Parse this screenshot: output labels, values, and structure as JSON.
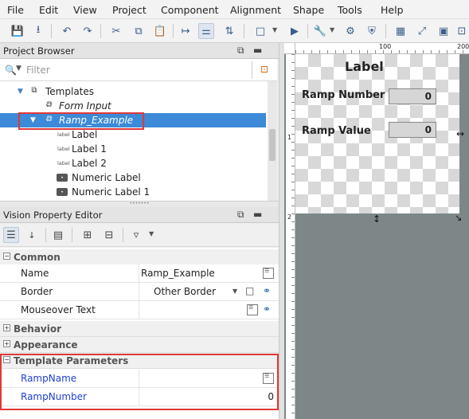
{
  "menubar": {
    "items": [
      "File",
      "Edit",
      "View",
      "Project",
      "Component",
      "Alignment",
      "Shape",
      "Tools",
      "Help"
    ]
  },
  "project_browser": {
    "title": "Project Browser",
    "filter_placeholder": "Filter",
    "tree": [
      {
        "label": "Templates",
        "icon": "folder-icon",
        "italic": false
      },
      {
        "label": "Form Input",
        "icon": "template-icon",
        "italic": true
      },
      {
        "label": "Ramp_Example",
        "icon": "template-icon",
        "italic": true,
        "selected": true
      },
      {
        "label": "Label",
        "icon": "label-icon",
        "italic": false
      },
      {
        "label": "Label 1",
        "icon": "label-icon",
        "italic": false
      },
      {
        "label": "Label 2",
        "icon": "label-icon",
        "italic": false
      },
      {
        "label": "Numeric Label",
        "icon": "numeric-label-icon",
        "italic": false
      },
      {
        "label": "Numeric Label 1",
        "icon": "numeric-label-icon",
        "italic": false
      }
    ],
    "label_icon_text": "label"
  },
  "property_editor": {
    "title": "Vision Property Editor",
    "categories": {
      "common": "Common",
      "behavior": "Behavior",
      "appearance": "Appearance",
      "template_parameters": "Template Parameters"
    },
    "rows": {
      "name": {
        "key": "Name",
        "value": "Ramp_Example"
      },
      "border": {
        "key": "Border",
        "value": "Other Border"
      },
      "mouseover": {
        "key": "Mouseover Text",
        "value": ""
      },
      "ramp_name": {
        "key": "RampName",
        "value": ""
      },
      "ramp_number": {
        "key": "RampNumber",
        "value": "0"
      }
    }
  },
  "designer": {
    "ruler_h": [
      "100",
      "200"
    ],
    "ruler_v": [
      "1",
      "2"
    ],
    "title_label": "Label",
    "ramp_number_label": "Ramp Number",
    "ramp_number_value": "0",
    "ramp_value_label": "Ramp Value",
    "ramp_value_value": "0"
  }
}
